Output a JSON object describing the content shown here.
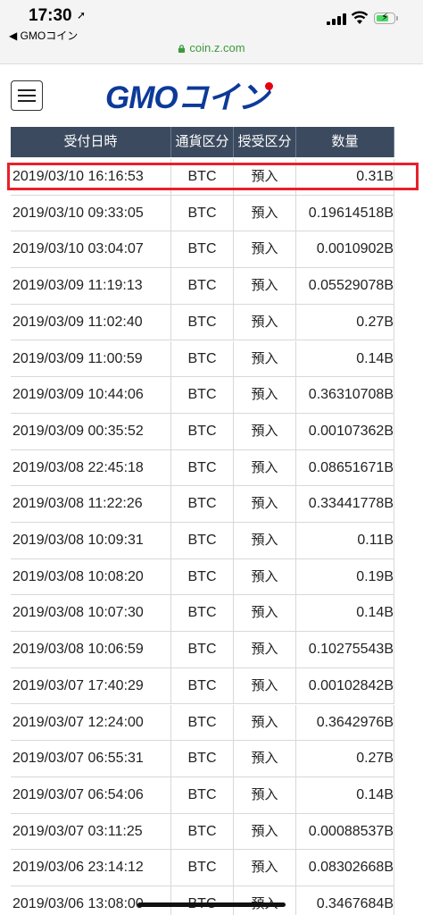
{
  "status": {
    "time": "17:30",
    "location_icon": "location-arrow-icon",
    "back_label": "◀ GMOコイン",
    "url": "coin.z.com"
  },
  "header": {
    "logo_text": "GMOコイン",
    "menu_icon": "hamburger-menu-icon"
  },
  "table": {
    "columns": [
      "受付日時",
      "通貨区分",
      "授受区分",
      "数量"
    ],
    "rows": [
      {
        "datetime": "2019/03/10 16:16:53",
        "currency": "BTC",
        "type": "預入",
        "amount": "0.31B"
      },
      {
        "datetime": "2019/03/10 09:33:05",
        "currency": "BTC",
        "type": "預入",
        "amount": "0.19614518B"
      },
      {
        "datetime": "2019/03/10 03:04:07",
        "currency": "BTC",
        "type": "預入",
        "amount": "0.0010902B"
      },
      {
        "datetime": "2019/03/09 11:19:13",
        "currency": "BTC",
        "type": "預入",
        "amount": "0.05529078B"
      },
      {
        "datetime": "2019/03/09 11:02:40",
        "currency": "BTC",
        "type": "預入",
        "amount": "0.27B"
      },
      {
        "datetime": "2019/03/09 11:00:59",
        "currency": "BTC",
        "type": "預入",
        "amount": "0.14B"
      },
      {
        "datetime": "2019/03/09 10:44:06",
        "currency": "BTC",
        "type": "預入",
        "amount": "0.36310708B"
      },
      {
        "datetime": "2019/03/09 00:35:52",
        "currency": "BTC",
        "type": "預入",
        "amount": "0.00107362B"
      },
      {
        "datetime": "2019/03/08 22:45:18",
        "currency": "BTC",
        "type": "預入",
        "amount": "0.08651671B"
      },
      {
        "datetime": "2019/03/08 11:22:26",
        "currency": "BTC",
        "type": "預入",
        "amount": "0.33441778B"
      },
      {
        "datetime": "2019/03/08 10:09:31",
        "currency": "BTC",
        "type": "預入",
        "amount": "0.11B"
      },
      {
        "datetime": "2019/03/08 10:08:20",
        "currency": "BTC",
        "type": "預入",
        "amount": "0.19B"
      },
      {
        "datetime": "2019/03/08 10:07:30",
        "currency": "BTC",
        "type": "預入",
        "amount": "0.14B"
      },
      {
        "datetime": "2019/03/08 10:06:59",
        "currency": "BTC",
        "type": "預入",
        "amount": "0.10275543B"
      },
      {
        "datetime": "2019/03/07 17:40:29",
        "currency": "BTC",
        "type": "預入",
        "amount": "0.00102842B"
      },
      {
        "datetime": "2019/03/07 12:24:00",
        "currency": "BTC",
        "type": "預入",
        "amount": "0.3642976B"
      },
      {
        "datetime": "2019/03/07 06:55:31",
        "currency": "BTC",
        "type": "預入",
        "amount": "0.27B"
      },
      {
        "datetime": "2019/03/07 06:54:06",
        "currency": "BTC",
        "type": "預入",
        "amount": "0.14B"
      },
      {
        "datetime": "2019/03/07 03:11:25",
        "currency": "BTC",
        "type": "預入",
        "amount": "0.00088537B"
      },
      {
        "datetime": "2019/03/06 23:14:12",
        "currency": "BTC",
        "type": "預入",
        "amount": "0.08302668B"
      },
      {
        "datetime": "2019/03/06 13:08:00",
        "currency": "BTC",
        "type": "預入",
        "amount": "0.3467684B"
      }
    ]
  },
  "colors": {
    "header_bg": "#3b4a5e",
    "logo_blue": "#0d3a99",
    "logo_red": "#e50012",
    "highlight": "#e8202a",
    "url_green": "#3c9b3c"
  }
}
